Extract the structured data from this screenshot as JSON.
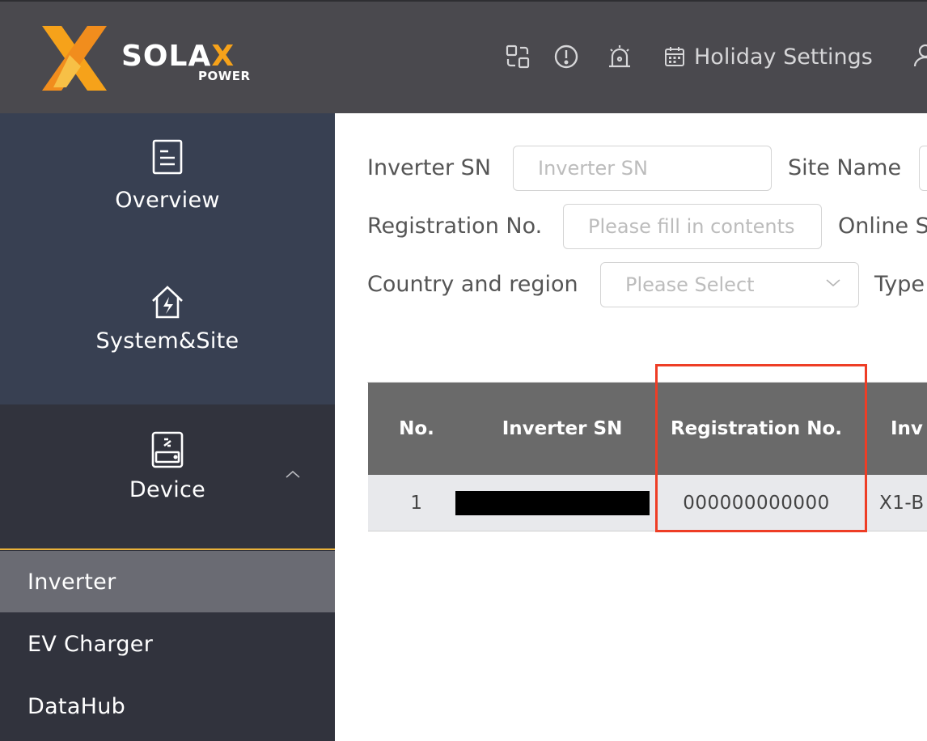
{
  "brand": {
    "name_part1": "SOLA",
    "name_part2": "X",
    "subtitle": "POWER",
    "accent_color": "#f6a21a"
  },
  "topbar": {
    "icons": [
      "switch-icon",
      "alert-icon",
      "alarm-icon"
    ],
    "holiday_label": "Holiday Settings",
    "user_icon": "user-icon"
  },
  "sidebar": {
    "overview_label": "Overview",
    "system_label": "System&Site",
    "device_label": "Device",
    "subitems": [
      {
        "label": "Inverter",
        "active": true
      },
      {
        "label": "EV Charger",
        "active": false
      },
      {
        "label": "DataHub",
        "active": false
      }
    ]
  },
  "filters": {
    "inverter_sn": {
      "label": "Inverter SN",
      "placeholder": "Inverter SN"
    },
    "site_name": {
      "label": "Site Name"
    },
    "registration_no": {
      "label": "Registration No.",
      "placeholder": "Please fill in contents"
    },
    "online_status": {
      "label": "Online S"
    },
    "country": {
      "label": "Country and region",
      "placeholder": "Please Select"
    },
    "type": {
      "label": "Type"
    }
  },
  "table": {
    "headers": [
      "No.",
      "Inverter SN",
      "Registration No.",
      "Inv"
    ],
    "rows": [
      {
        "no": "1",
        "registration_no": "000000000000",
        "inverter_type": "X1-B"
      }
    ]
  },
  "highlight_color": "#ee3d25"
}
